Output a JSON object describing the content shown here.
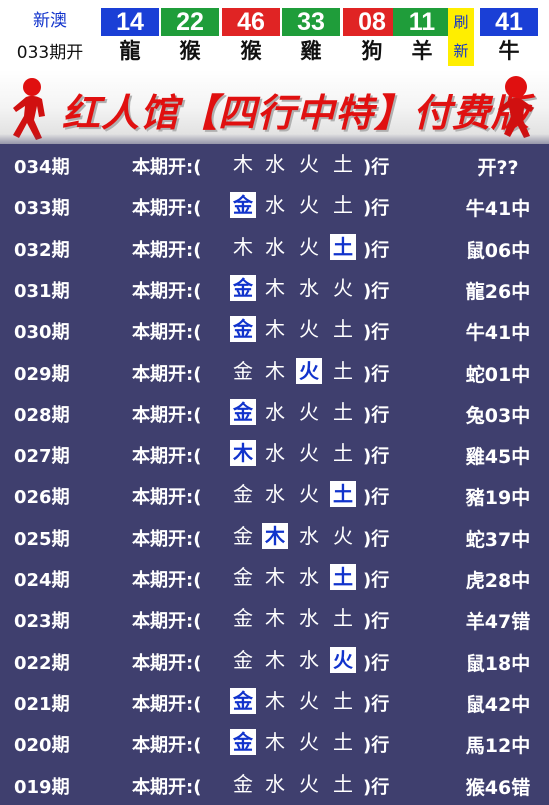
{
  "header": {
    "brand_line1": "新澳",
    "brand_line2": "033期开",
    "balls": [
      {
        "num": "14",
        "zodiac": "龍",
        "color": "#1a3fd6"
      },
      {
        "num": "22",
        "zodiac": "猴",
        "color": "#1f9d3a"
      },
      {
        "num": "46",
        "zodiac": "猴",
        "color": "#e02424"
      },
      {
        "num": "33",
        "zodiac": "雞",
        "color": "#1f9d3a"
      },
      {
        "num": "08",
        "zodiac": "狗",
        "color": "#e02424"
      },
      {
        "num": "11",
        "zodiac": "羊",
        "color": "#1f9d3a"
      }
    ],
    "refresh_top": "刷",
    "refresh_bottom": "新",
    "special": {
      "num": "41",
      "zodiac": "牛",
      "color": "#1a3fd6"
    }
  },
  "banner": {
    "title": "红人馆【四行中特】付费版"
  },
  "table": {
    "label": "本期开:(",
    "close": ")行",
    "rows": [
      {
        "period": "034期",
        "elements": [
          "木",
          "水",
          "火",
          "土"
        ],
        "highlight": [],
        "result": "开??"
      },
      {
        "period": "033期",
        "elements": [
          "金",
          "水",
          "火",
          "土"
        ],
        "highlight": [
          0
        ],
        "result": "牛41中"
      },
      {
        "period": "032期",
        "elements": [
          "木",
          "水",
          "火",
          "土"
        ],
        "highlight": [
          3
        ],
        "result": "鼠06中"
      },
      {
        "period": "031期",
        "elements": [
          "金",
          "木",
          "水",
          "火"
        ],
        "highlight": [
          0
        ],
        "result": "龍26中"
      },
      {
        "period": "030期",
        "elements": [
          "金",
          "木",
          "火",
          "土"
        ],
        "highlight": [
          0
        ],
        "result": "牛41中"
      },
      {
        "period": "029期",
        "elements": [
          "金",
          "木",
          "火",
          "土"
        ],
        "highlight": [
          2
        ],
        "result": "蛇01中"
      },
      {
        "period": "028期",
        "elements": [
          "金",
          "水",
          "火",
          "土"
        ],
        "highlight": [
          0
        ],
        "result": "兔03中"
      },
      {
        "period": "027期",
        "elements": [
          "木",
          "水",
          "火",
          "土"
        ],
        "highlight": [
          0
        ],
        "result": "雞45中"
      },
      {
        "period": "026期",
        "elements": [
          "金",
          "水",
          "火",
          "土"
        ],
        "highlight": [
          3
        ],
        "result": "豬19中"
      },
      {
        "period": "025期",
        "elements": [
          "金",
          "木",
          "水",
          "火"
        ],
        "highlight": [
          1
        ],
        "result": "蛇37中"
      },
      {
        "period": "024期",
        "elements": [
          "金",
          "木",
          "水",
          "土"
        ],
        "highlight": [
          3
        ],
        "result": "虎28中"
      },
      {
        "period": "023期",
        "elements": [
          "金",
          "木",
          "水",
          "土"
        ],
        "highlight": [],
        "result": "羊47错"
      },
      {
        "period": "022期",
        "elements": [
          "金",
          "木",
          "水",
          "火"
        ],
        "highlight": [
          3
        ],
        "result": "鼠18中"
      },
      {
        "period": "021期",
        "elements": [
          "金",
          "木",
          "火",
          "土"
        ],
        "highlight": [
          0
        ],
        "result": "鼠42中"
      },
      {
        "period": "020期",
        "elements": [
          "金",
          "木",
          "火",
          "土"
        ],
        "highlight": [
          0
        ],
        "result": "馬12中"
      },
      {
        "period": "019期",
        "elements": [
          "金",
          "水",
          "火",
          "土"
        ],
        "highlight": [],
        "result": "猴46错"
      }
    ]
  }
}
